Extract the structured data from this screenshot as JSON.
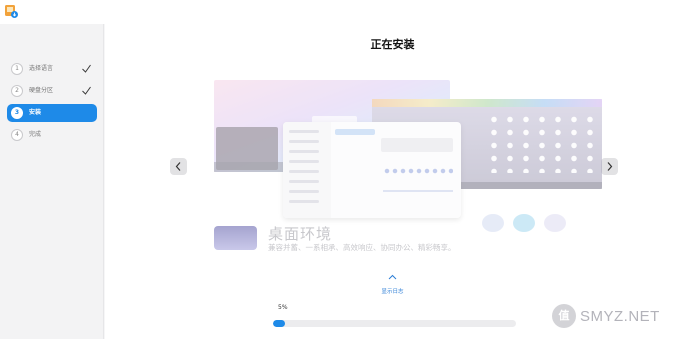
{
  "steps": [
    {
      "num": "1",
      "label": "选择语言",
      "state": "done"
    },
    {
      "num": "2",
      "label": "硬盘分区",
      "state": "done"
    },
    {
      "num": "3",
      "label": "安装",
      "state": "active"
    },
    {
      "num": "4",
      "label": "完成",
      "state": "pending"
    }
  ],
  "main": {
    "title": "正在安装",
    "feature_title": "桌面环境",
    "feature_desc": "兼容并蓄、一系相承、高效响应、协同办公、精彩畅享。",
    "log_label": "显示日志",
    "progress_text": "5%",
    "progress_value": 5
  },
  "watermark": {
    "badge": "值",
    "text": "SMYZ.NET"
  },
  "colors": {
    "accent": "#1e8ae8",
    "sidebar_bg": "#f3f3f4"
  }
}
